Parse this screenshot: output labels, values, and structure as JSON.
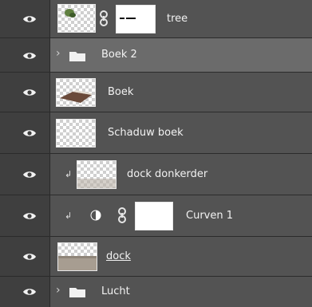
{
  "layers": [
    {
      "label": "tree",
      "kind": "layer-with-mask"
    },
    {
      "label": "Boek 2",
      "kind": "group",
      "selected": true
    },
    {
      "label": "Boek",
      "kind": "layer"
    },
    {
      "label": "Schaduw boek",
      "kind": "layer"
    },
    {
      "label": "dock donkerder",
      "kind": "clipped-layer"
    },
    {
      "label": "Curven 1",
      "kind": "adjustment-curves"
    },
    {
      "label": "dock",
      "kind": "layer"
    },
    {
      "label": "Lucht",
      "kind": "group"
    }
  ],
  "icons": {
    "visibility": "eye-icon",
    "link": "chain-link-icon",
    "group": "folder-icon",
    "expand": "chevron-right-icon",
    "clip": "clipping-arrow-icon",
    "adjustment": "adjustment-layer-icon"
  },
  "colors": {
    "panel_bg": "#535353",
    "selected_row_bg": "#6b6b6b",
    "eye_column_bg": "#3f3f3f",
    "text": "#f2f2f2"
  }
}
